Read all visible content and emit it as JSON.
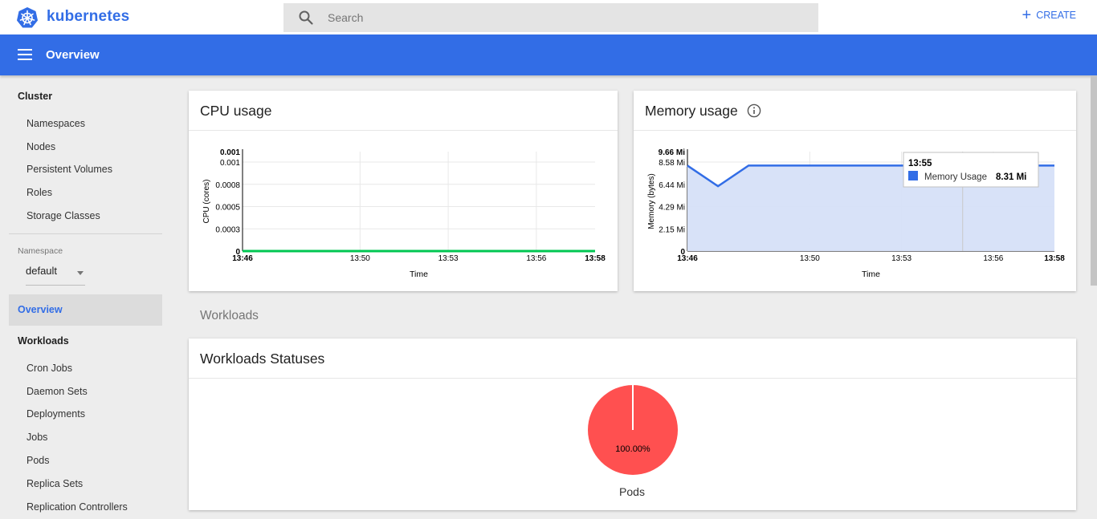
{
  "app": {
    "brand": "kubernetes"
  },
  "search": {
    "placeholder": "Search"
  },
  "actions": {
    "create_label": "CREATE"
  },
  "header": {
    "title": "Overview"
  },
  "sidebar": {
    "cluster_heading": "Cluster",
    "cluster_items": [
      "Namespaces",
      "Nodes",
      "Persistent Volumes",
      "Roles",
      "Storage Classes"
    ],
    "namespace_label": "Namespace",
    "namespace_value": "default",
    "active_item": "Overview",
    "workloads_heading": "Workloads",
    "workloads_items": [
      "Cron Jobs",
      "Daemon Sets",
      "Deployments",
      "Jobs",
      "Pods",
      "Replica Sets",
      "Replication Controllers"
    ]
  },
  "cpu_card": {
    "title": "CPU usage"
  },
  "memory_card": {
    "title": "Memory usage"
  },
  "workloads_section": {
    "heading": "Workloads"
  },
  "statuses_card": {
    "title": "Workloads Statuses"
  },
  "colors": {
    "brand": "#326de6",
    "cpu_line": "#00c752",
    "memory_line": "#326de6",
    "memory_fill": "#d6e0f8",
    "pods_failed": "#ff5050"
  },
  "chart_data": [
    {
      "type": "line",
      "title": "CPU usage",
      "xlabel": "Time",
      "ylabel": "CPU (cores)",
      "x_ticks": [
        "13:46",
        "13:50",
        "13:53",
        "13:56",
        "13:58"
      ],
      "y_ticks": [
        "0",
        "0.0003",
        "0.0005",
        "0.0008",
        "0.001",
        "0.001"
      ],
      "ylim": [
        0,
        0.001
      ],
      "grid": true,
      "series": [
        {
          "color": "#00c752",
          "x": [
            "13:46",
            "13:47",
            "13:48",
            "13:49",
            "13:50",
            "13:51",
            "13:52",
            "13:53",
            "13:54",
            "13:55",
            "13:56",
            "13:57",
            "13:58"
          ],
          "values": [
            0,
            0,
            0,
            0,
            0,
            0,
            0,
            0,
            0,
            0,
            0,
            0,
            0
          ]
        }
      ]
    },
    {
      "type": "area",
      "title": "Memory usage",
      "xlabel": "Time",
      "ylabel": "Memory (bytes)",
      "x_ticks": [
        "13:46",
        "13:50",
        "13:53",
        "13:56",
        "13:58"
      ],
      "y_ticks": [
        "0",
        "2.15 Mi",
        "4.29 Mi",
        "6.44 Mi",
        "8.58 Mi",
        "9.66 Mi"
      ],
      "ylim": [
        0,
        9.66
      ],
      "grid": true,
      "series": [
        {
          "name": "Memory Usage",
          "color": "#326de6",
          "x": [
            "13:46",
            "13:47",
            "13:48",
            "13:49",
            "13:50",
            "13:51",
            "13:52",
            "13:53",
            "13:54",
            "13:55",
            "13:56",
            "13:57",
            "13:58"
          ],
          "values": [
            8.3,
            6.3,
            8.31,
            8.31,
            8.31,
            8.31,
            8.31,
            8.31,
            8.31,
            8.31,
            8.31,
            8.31,
            8.31
          ]
        }
      ],
      "tooltip": {
        "time": "13:55",
        "label": "Memory Usage",
        "value": "8.31 Mi"
      }
    },
    {
      "type": "pie",
      "label": "Pods",
      "slices": [
        {
          "value": 100.0,
          "label": "100.00%",
          "color": "#ff5050"
        }
      ]
    }
  ]
}
